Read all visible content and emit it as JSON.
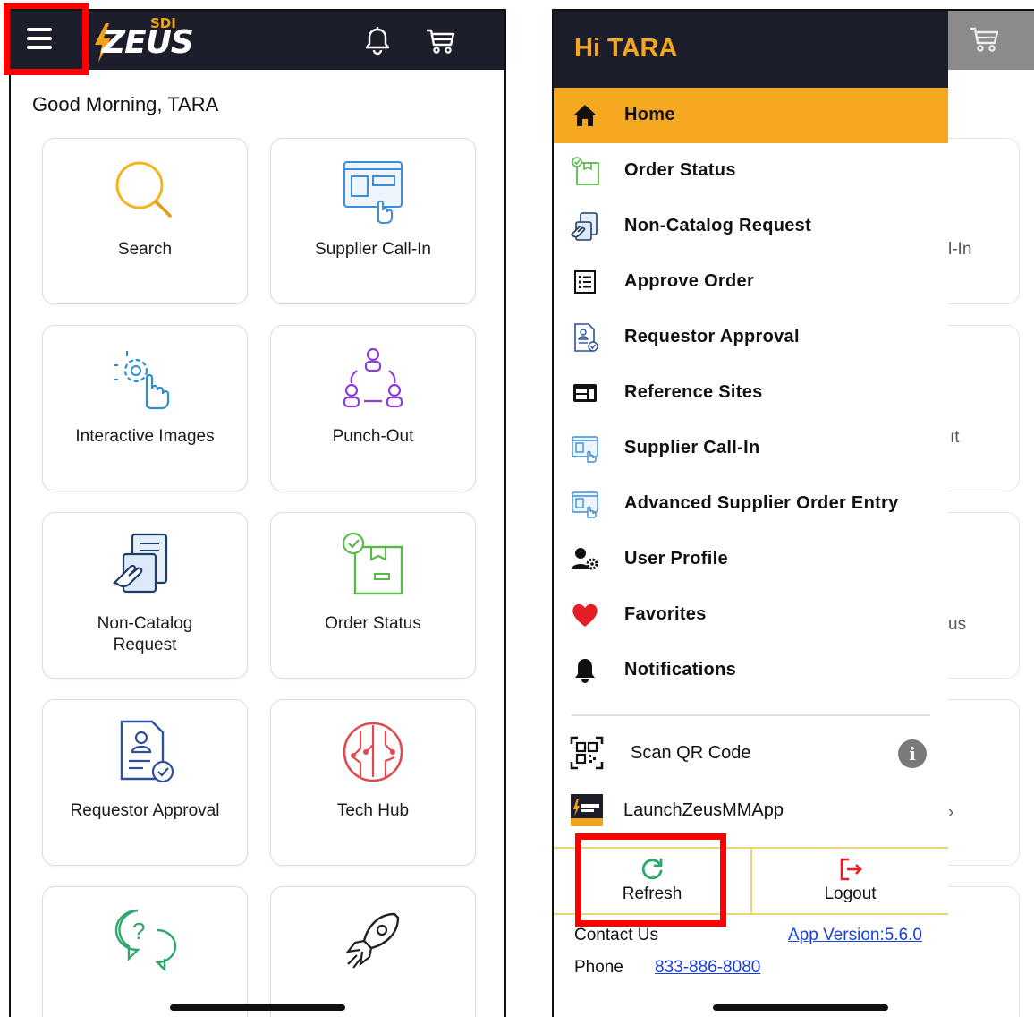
{
  "left_screen": {
    "greeting": "Good Morning, TARA",
    "logo": {
      "brand": "ZEUS",
      "sub": "SDI"
    },
    "tiles": [
      {
        "label": "Search",
        "icon": "search-icon"
      },
      {
        "label": "Supplier Call-In",
        "icon": "supplier-call-in-icon"
      },
      {
        "label": "Interactive Images",
        "icon": "interactive-images-icon"
      },
      {
        "label": "Punch-Out",
        "icon": "punch-out-icon"
      },
      {
        "label": "Non-Catalog\nRequest",
        "icon": "non-catalog-request-icon"
      },
      {
        "label": "Order Status",
        "icon": "order-status-icon"
      },
      {
        "label": "Requestor Approval",
        "icon": "requestor-approval-icon"
      },
      {
        "label": "Tech Hub",
        "icon": "tech-hub-icon"
      },
      {
        "label": "",
        "icon": "help-chat-icon"
      },
      {
        "label": "",
        "icon": "rocket-icon"
      }
    ]
  },
  "drawer": {
    "title": "Hi TARA",
    "menu": [
      {
        "label": "Home",
        "icon": "home-icon",
        "active": true
      },
      {
        "label": "Order Status",
        "icon": "order-status-icon"
      },
      {
        "label": "Non-Catalog Request",
        "icon": "non-catalog-request-icon"
      },
      {
        "label": "Approve Order",
        "icon": "approve-order-icon"
      },
      {
        "label": "Requestor Approval",
        "icon": "requestor-approval-icon"
      },
      {
        "label": "Reference Sites",
        "icon": "reference-sites-icon"
      },
      {
        "label": "Supplier Call-In",
        "icon": "supplier-call-in-icon"
      },
      {
        "label": "Advanced Supplier Order Entry",
        "icon": "advanced-supplier-order-icon"
      },
      {
        "label": "User Profile",
        "icon": "user-profile-icon"
      },
      {
        "label": "Favorites",
        "icon": "heart-icon"
      },
      {
        "label": "Notifications",
        "icon": "bell-icon"
      }
    ],
    "extras": [
      {
        "label": "Scan QR Code",
        "icon": "qr-code-icon"
      },
      {
        "label": "LaunchZeusMMApp",
        "icon": "zeus-app-icon"
      }
    ],
    "info_glyph": "i",
    "refresh_label": "Refresh",
    "logout_label": "Logout",
    "contact_label": "Contact Us",
    "app_version": "App Version:5.6.0",
    "phone_label": "Phone",
    "phone_number": "833-886-8080"
  },
  "peek": {
    "t1": "l-In",
    "t2": "ıt",
    "t3": "us",
    "t4": "›"
  },
  "colors": {
    "header": "#1c1f2b",
    "accent": "#f5a920",
    "highlight_box": "#ff0000",
    "link": "#1a3fd6"
  }
}
